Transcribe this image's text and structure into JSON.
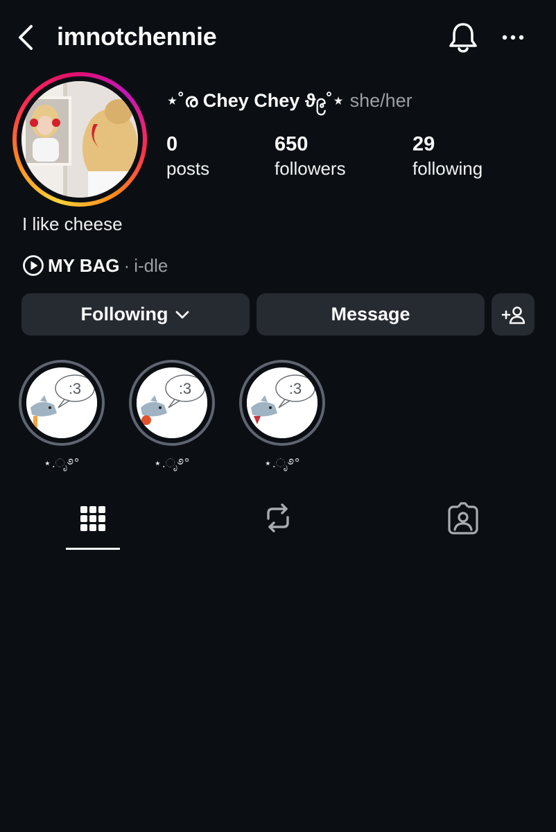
{
  "header": {
    "username": "imnotchennie",
    "back_icon": "chevron-left-icon",
    "bell_icon": "bell-icon",
    "more_icon": "more-horizontal-icon"
  },
  "profile": {
    "display_name": "⋆˚ര Chey Chey ϑ၉˚⋆",
    "pronouns": "she/her",
    "stats": [
      {
        "value": "0",
        "label": "posts"
      },
      {
        "value": "650",
        "label": "followers"
      },
      {
        "value": "29",
        "label": "following"
      }
    ],
    "bio": "I like cheese",
    "music": {
      "song": "MY BAG",
      "separator": "·",
      "artist": "i-dle",
      "icon": "play-circle-icon"
    }
  },
  "actions": {
    "following_label": "Following",
    "message_label": "Message",
    "add_user_icon": "add-user-icon"
  },
  "highlights": [
    {
      "label": "⋆.ೃ࿔°",
      "bubble_text": ":3"
    },
    {
      "label": "⋆.ೃ࿔°",
      "bubble_text": ":3"
    },
    {
      "label": "⋆.ೃ࿔°",
      "bubble_text": ":3"
    }
  ],
  "tabs": [
    {
      "name": "grid",
      "icon": "grid-icon",
      "active": true
    },
    {
      "name": "reposts",
      "icon": "repost-icon",
      "active": false
    },
    {
      "name": "tagged",
      "icon": "tagged-icon",
      "active": false
    }
  ],
  "colors": {
    "background": "#0b0f13",
    "button": "#262a31",
    "muted_text": "#9aa0a6",
    "story_gradient": [
      "#ffd23a",
      "#ff2a52",
      "#c416b8"
    ]
  }
}
